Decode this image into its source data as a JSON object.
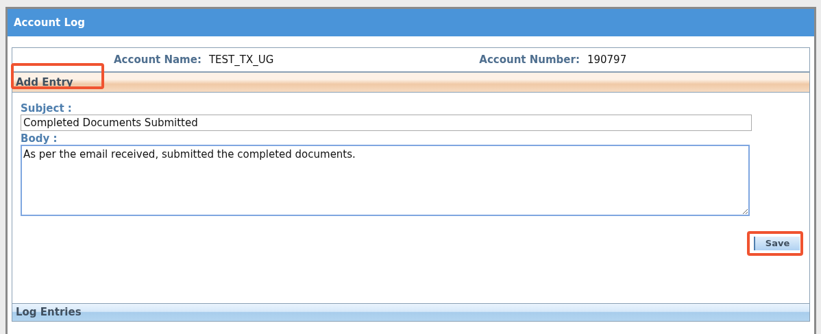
{
  "window": {
    "title": "Account Log"
  },
  "account": {
    "name_label": "Account Name:",
    "name": "TEST_TX_UG",
    "number_label": "Account Number:",
    "number": "190797"
  },
  "add_entry": {
    "title": "Add Entry",
    "highlighted": true,
    "subject": {
      "label": "Subject :",
      "value": "Completed Documents Submitted"
    },
    "body": {
      "label": "Body :",
      "value": "As per the email received, submitted the completed documents. ",
      "focused": true
    },
    "save": {
      "label": "Save",
      "highlighted": true
    }
  },
  "log_entries": {
    "title": "Log Entries"
  }
}
